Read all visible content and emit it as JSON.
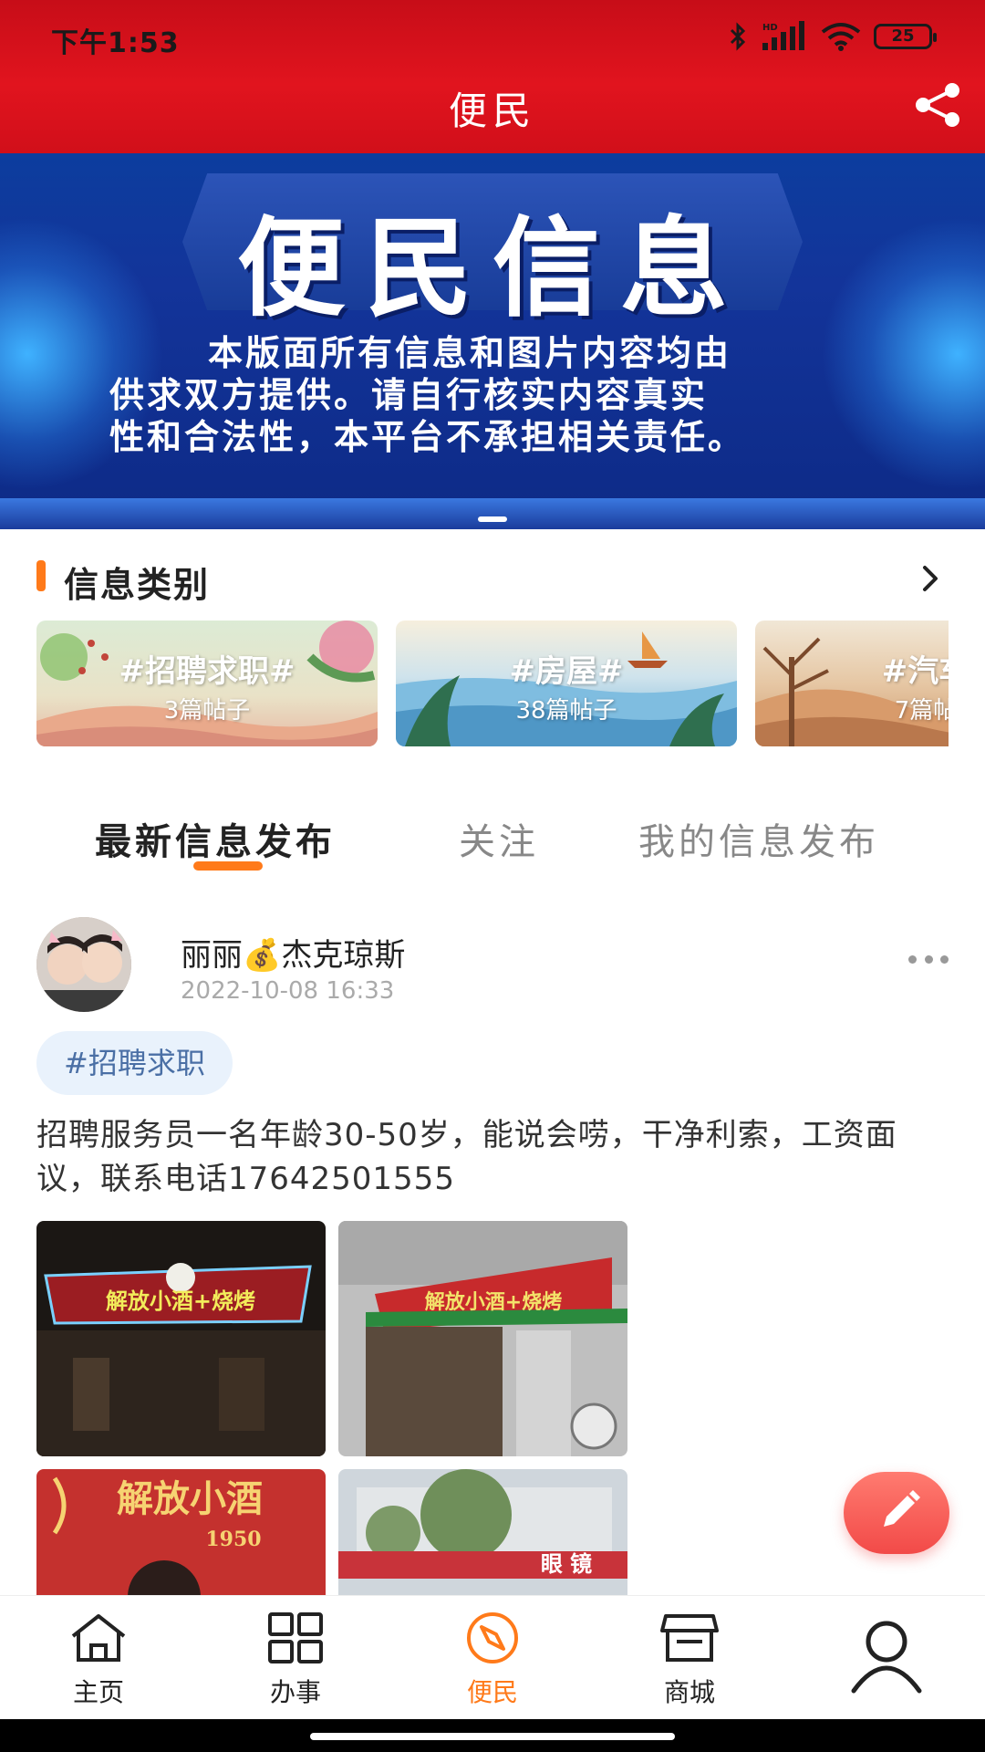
{
  "status_bar": {
    "time": "下午1:53",
    "battery": "25",
    "network": "HD"
  },
  "header": {
    "title": "便民"
  },
  "banner": {
    "title": "便民信息",
    "lines": [
      "本版面所有信息和图片内容均由",
      "供求双方提供。请自行核实内容真实",
      "性和合法性，本平台不承担相关责任。"
    ]
  },
  "categories": {
    "title": "信息类别",
    "items": [
      {
        "name": "#招聘求职#",
        "count": "3篇帖子"
      },
      {
        "name": "#房屋#",
        "count": "38篇帖子"
      },
      {
        "name": "#汽车",
        "count": "7篇帖"
      }
    ]
  },
  "tabs": [
    "最新信息发布",
    "关注",
    "我的信息发布"
  ],
  "post": {
    "author": "丽丽💰杰克琼斯",
    "time": "2022-10-08 16:33",
    "tag": "#招聘求职",
    "text": "招聘服务员一名年龄30-50岁，能说会唠，干净利索，工资面议，联系电话17642501555",
    "photos": [
      {
        "sign": "解放小酒+烧烤"
      },
      {
        "sign": "解放小酒+烧烤"
      },
      {
        "sign": "解放小酒",
        "sub": "1950"
      },
      {
        "sign": "眼 镜"
      }
    ]
  },
  "tabbar": {
    "items": [
      {
        "label": "主页",
        "icon": "home-icon"
      },
      {
        "label": "办事",
        "icon": "grid-icon"
      },
      {
        "label": "便民",
        "icon": "compass-icon",
        "active": true
      },
      {
        "label": "商城",
        "icon": "store-icon"
      },
      {
        "label": "",
        "icon": "profile-icon"
      }
    ]
  },
  "colors": {
    "header_red": "#e1141e",
    "accent_orange": "#ff7a1a",
    "fab_red": "#f24a48",
    "tag_bg": "#e9f2fc"
  }
}
